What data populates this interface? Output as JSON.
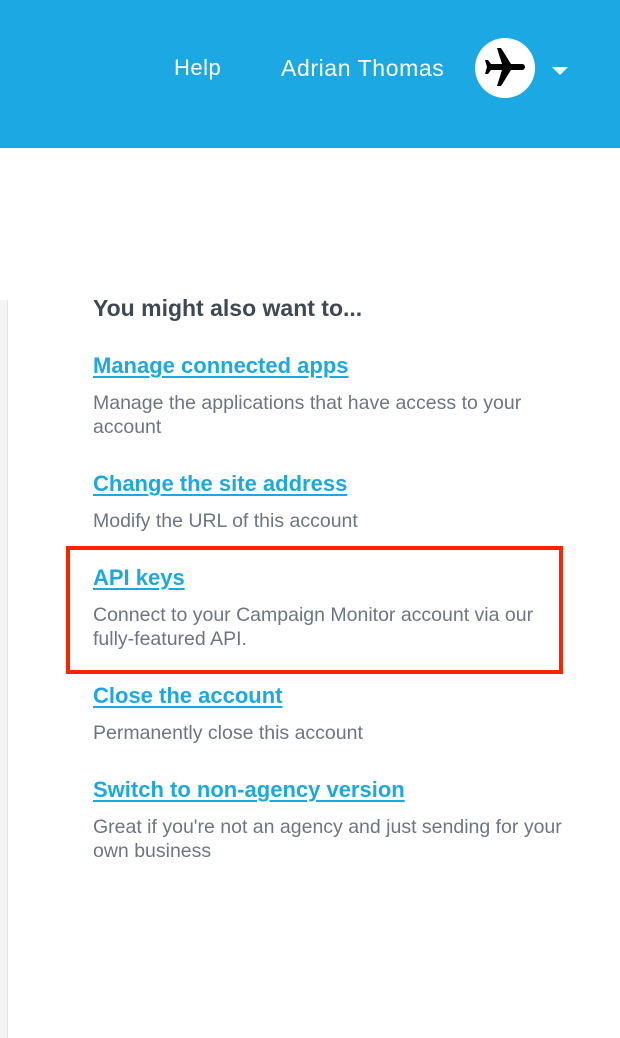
{
  "header": {
    "help_label": "Help",
    "user_name": "Adrian Thomas",
    "avatar_icon": "airplane-icon",
    "dropdown_icon": "caret-down-icon",
    "background_color": "#1ca8e3"
  },
  "main": {
    "section_title": "You might also want to...",
    "items": [
      {
        "link": "Manage connected apps",
        "description": "Manage the applications that have access to your account"
      },
      {
        "link": "Change the site address",
        "description": "Modify the URL of this account"
      },
      {
        "link": "API keys",
        "description": "Connect to your Campaign Monitor account via our fully-featured API.",
        "highlighted": true
      },
      {
        "link": "Close the account",
        "description": "Permanently close this account"
      },
      {
        "link": "Switch to non-agency version",
        "description": "Great if you're not an agency and just sending for your own business"
      }
    ]
  },
  "colors": {
    "link": "#1ca8e3",
    "title": "#3e4955",
    "description": "#6d7680",
    "highlight": "#ff2200"
  }
}
